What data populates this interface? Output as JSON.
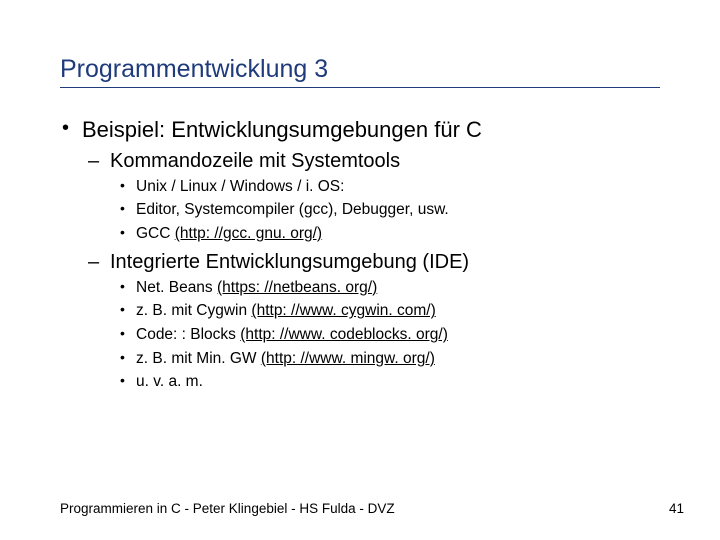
{
  "title": "Programmentwicklung 3",
  "body": {
    "b1_label": "Beispiel: Entwicklungsumgebungen für C",
    "sec1": {
      "heading": "Kommandozeile mit Systemtools",
      "i1": "Unix / Linux / Windows / i. OS:",
      "i2": "Editor, Systemcompiler (gcc), Debugger, usw.",
      "i3_pre": "GCC ",
      "i3_link": "(http: //gcc. gnu. org/)"
    },
    "sec2": {
      "heading": "Integrierte Entwicklungsumgebung (IDE)",
      "i1_pre": "Net. Beans ",
      "i1_link": "(https: //netbeans. org/)",
      "i2_pre": "z. B. mit Cygwin ",
      "i2_link": "(http: //www. cygwin. com/)",
      "i3_pre": "Code: : Blocks ",
      "i3_link": "(http: //www. codeblocks. org/)",
      "i4_pre": "z. B. mit Min. GW ",
      "i4_link": "(http: //www. mingw. org/)",
      "i5": "u. v. a. m."
    }
  },
  "footer_left": "Programmieren in C - Peter Klingebiel - HS Fulda - DVZ",
  "footer_right": "41"
}
